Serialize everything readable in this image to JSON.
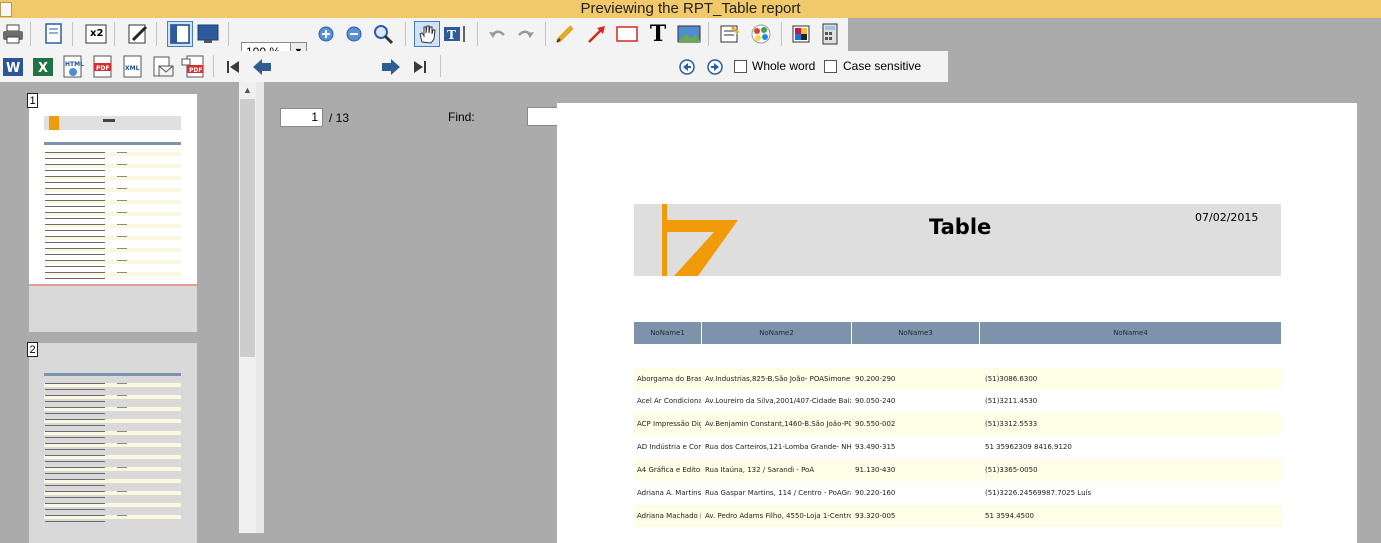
{
  "window": {
    "title": "Previewing the RPT_Table report"
  },
  "toolbar": {
    "zoom": "100 %",
    "page_current": "1",
    "page_total": "/ 13",
    "find_label": "Find:",
    "find_value": "",
    "whole_word_label": "Whole word",
    "case_sensitive_label": "Case sensitive"
  },
  "thumbnails": {
    "items": [
      {
        "label": "1"
      },
      {
        "label": "2"
      }
    ]
  },
  "report": {
    "title": "Table",
    "date": "07/02/2015",
    "columns": [
      "NoName1",
      "NoName2",
      "NoName3",
      "NoName4"
    ],
    "rows": [
      [
        "Aborgama do Brasil",
        "Av.Industrias,825-B.São João- POASimone com",
        "90.200-290",
        "(51)3086.6300"
      ],
      [
        "Acel Ar Condicionad",
        "Av.Loureiro da Silva,2001/407-Cidade Baixa-PO",
        "90.050-240",
        "(51)3211.4530"
      ],
      [
        "ACP Impressão Digit",
        "Av.Benjamin Constant,1460-B.São João-POA gr",
        "90.550-002",
        "(51)3312.5533"
      ],
      [
        "AD Indústria e Com",
        "Rua dos Carteiros,121-Lomba Grande- NH ade",
        "93.490-315",
        "51 35962309 8416.9120"
      ],
      [
        "A4 Gráfica e Editor",
        "Rua Itaúna, 132 / Sarandi - PoA",
        "91.130-430",
        "(51)3365-0050"
      ],
      [
        "Adriana A. Martins",
        "Rua Gaspar Martins, 114 / Centro - PoAGráfica.",
        "90.220-160",
        "(51)3226.24569987.7025 Luís"
      ],
      [
        "Adriana Machado La",
        "Av. Pedro Adams Filho, 4550-Loja 1-Centro-NH",
        "93.320-005",
        "51 3594.4500"
      ]
    ]
  },
  "colors": {
    "title_bar": "#f1c96a",
    "header_fill": "#7d93ab",
    "row_alt": "#fefde6",
    "logo_orange": "#f29b0a"
  }
}
